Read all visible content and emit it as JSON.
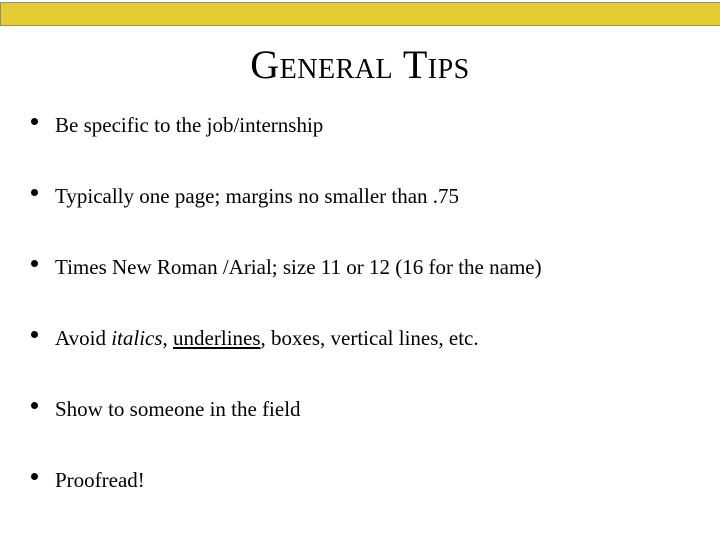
{
  "slide": {
    "title": "General Tips",
    "background_color": "#ffffff",
    "text_color": "#000000"
  },
  "banner": {
    "fill_color": "#e6cc33",
    "border_color": "#8f9470"
  },
  "bullets": [
    {
      "marker": "bullet-dot",
      "text": "Be specific to the job/internship",
      "segments": [
        {
          "text": "Be specific to the job/internship",
          "style": "normal"
        }
      ]
    },
    {
      "marker": "bullet-dot",
      "text": "Typically one page; margins no smaller than .75",
      "segments": [
        {
          "text": "Typically one page; margins no smaller than .75",
          "style": "normal"
        }
      ]
    },
    {
      "marker": "bullet-dot",
      "text": "Times New Roman /Arial; size 11 or 12 (16 for the name)",
      "segments": [
        {
          "text": "Times New Roman /Arial; size 11 or 12 (16 for the name)",
          "style": "normal"
        }
      ]
    },
    {
      "marker": "bullet-dot",
      "text": "Avoid italics, underlines, boxes, vertical lines, etc.",
      "segments": [
        {
          "text": "Avoid ",
          "style": "normal"
        },
        {
          "text": "italics",
          "style": "italic"
        },
        {
          "text": ", ",
          "style": "normal"
        },
        {
          "text": "underlines",
          "style": "underline"
        },
        {
          "text": ", boxes, vertical lines, etc.",
          "style": "normal"
        }
      ]
    },
    {
      "marker": "bullet-dot",
      "text": "Show to someone in the field",
      "segments": [
        {
          "text": "Show to someone in the field",
          "style": "normal"
        }
      ]
    },
    {
      "marker": "bullet-dot",
      "text": "Proofread!",
      "segments": [
        {
          "text": "Proofread!",
          "style": "normal"
        }
      ]
    }
  ]
}
